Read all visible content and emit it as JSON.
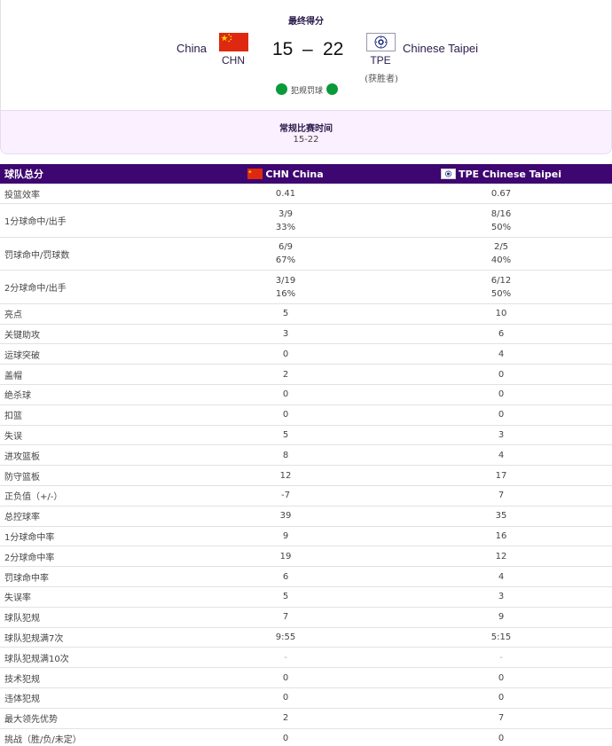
{
  "header": {
    "final_title": "最终得分",
    "team_a": {
      "name": "China",
      "code": "CHN",
      "score": "15",
      "flag": "china-flag"
    },
    "team_b": {
      "name": "Chinese Taipei",
      "code": "TPE",
      "score": "22",
      "flag": "chinese-taipei-flag",
      "winner_note": "(获胜者)"
    },
    "score_separator": "–",
    "foul_label": "犯规罚球",
    "foul_dot_color": "#0a9a3a"
  },
  "period": {
    "title": "常规比赛时间",
    "score": "15-22"
  },
  "table": {
    "header": {
      "title": "球队总分",
      "team_a": "CHN China",
      "team_b": "TPE Chinese Taipei",
      "header_color": "#3d0670"
    },
    "rows": [
      {
        "label": "投篮效率",
        "a": "0.41",
        "b": "0.67"
      },
      {
        "label": "1分球命中/出手",
        "a": "3/9",
        "a2": "33%",
        "b": "8/16",
        "b2": "50%"
      },
      {
        "label": "罚球命中/罚球数",
        "a": "6/9",
        "a2": "67%",
        "b": "2/5",
        "b2": "40%"
      },
      {
        "label": "2分球命中/出手",
        "a": "3/19",
        "a2": "16%",
        "b": "6/12",
        "b2": "50%"
      },
      {
        "label": "亮点",
        "a": "5",
        "b": "10"
      },
      {
        "label": "关键助攻",
        "a": "3",
        "b": "6"
      },
      {
        "label": "运球突破",
        "a": "0",
        "b": "4"
      },
      {
        "label": "盖帽",
        "a": "2",
        "b": "0"
      },
      {
        "label": "绝杀球",
        "a": "0",
        "b": "0"
      },
      {
        "label": "扣篮",
        "a": "0",
        "b": "0"
      },
      {
        "label": "失误",
        "a": "5",
        "b": "3"
      },
      {
        "label": "进攻篮板",
        "a": "8",
        "b": "4"
      },
      {
        "label": "防守篮板",
        "a": "12",
        "b": "17"
      },
      {
        "label": "正负值（+/-）",
        "a": "-7",
        "b": "7"
      },
      {
        "label": "总控球率",
        "a": "39",
        "b": "35"
      },
      {
        "label": "1分球命中率",
        "a": "9",
        "b": "16"
      },
      {
        "label": "2分球命中率",
        "a": "19",
        "b": "12"
      },
      {
        "label": "罚球命中率",
        "a": "6",
        "b": "4"
      },
      {
        "label": "失误率",
        "a": "5",
        "b": "3"
      },
      {
        "label": "球队犯规",
        "a": "7",
        "b": "9"
      },
      {
        "label": "球队犯规满7次",
        "a": "9:55",
        "b": "5:15"
      },
      {
        "label": "球队犯规满10次",
        "a": "-",
        "b": "-"
      },
      {
        "label": "技术犯规",
        "a": "0",
        "b": "0"
      },
      {
        "label": "违体犯规",
        "a": "0",
        "b": "0"
      },
      {
        "label": "最大领先优势",
        "a": "2",
        "b": "7"
      },
      {
        "label": "挑战（胜/负/未定）",
        "a": "0",
        "b": "0"
      }
    ]
  }
}
